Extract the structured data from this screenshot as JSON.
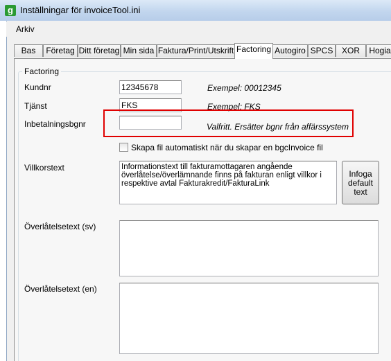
{
  "window": {
    "title": "Inställningar för invoiceTool.ini",
    "app_icon_glyph": "g"
  },
  "menu": {
    "arkiv": "Arkiv"
  },
  "tabs": [
    {
      "label": "Bas",
      "active": false
    },
    {
      "label": "Företag",
      "active": false
    },
    {
      "label": "Ditt företag",
      "active": false
    },
    {
      "label": "Min sida",
      "active": false
    },
    {
      "label": "Faktura/Print/Utskrift",
      "active": false
    },
    {
      "label": "Factoring",
      "active": true
    },
    {
      "label": "Autogiro",
      "active": false
    },
    {
      "label": "SPCS",
      "active": false
    },
    {
      "label": "XOR",
      "active": false
    },
    {
      "label": "Hogia",
      "active": false
    }
  ],
  "group": {
    "label": "Factoring"
  },
  "fields": {
    "kundnr": {
      "label": "Kundnr",
      "value": "12345678",
      "example": "Exempel: 00012345"
    },
    "tjanst": {
      "label": "Tjänst",
      "value": "FKS",
      "example": "Exempel: FKS"
    },
    "inbetalningsbgnr": {
      "label": "Inbetalningsbgnr",
      "value": "",
      "example": "Valfritt. Ersätter bgnr från affärssystem"
    }
  },
  "checkbox": {
    "label": "Skapa fil automatiskt när du skapar en bgcInvoice fil",
    "checked": false
  },
  "villkorstext": {
    "label": "Villkorstext",
    "value": "Informationstext till fakturamottagaren angående överlåtelse/överlämnande finns på fakturan enligt villkor i respektive avtal Fakturakredit/FakturaLink"
  },
  "infoga_button": "Infoga default text",
  "overlatelse_sv": {
    "label": "Överlåtelsetext (sv)",
    "value": ""
  },
  "overlatelse_en": {
    "label": "Överlåtelsetext (en)",
    "value": ""
  },
  "colors": {
    "highlight": "#e00000",
    "titlebar": "#c2d6ee",
    "app_icon": "#2a9a32"
  }
}
